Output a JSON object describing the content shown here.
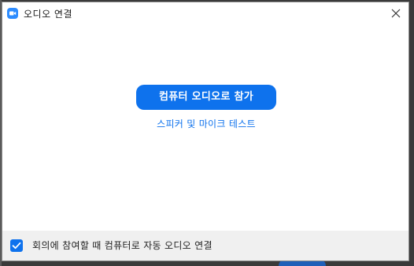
{
  "window": {
    "title": "오디오 연결",
    "logo_icon": "zoom-camera-icon",
    "close_icon": "close-icon"
  },
  "main": {
    "join_button_label": "컴퓨터 오디오로 참가",
    "test_link_label": "스피커 및 마이크 테스트"
  },
  "footer": {
    "auto_connect_checked": true,
    "auto_connect_label": "회의에 참여할 때 컴퓨터로 자동 오디오 연결"
  },
  "colors": {
    "accent": "#0e72ed",
    "logo": "#2d8cff",
    "footer_bg": "#f0f0f0"
  }
}
